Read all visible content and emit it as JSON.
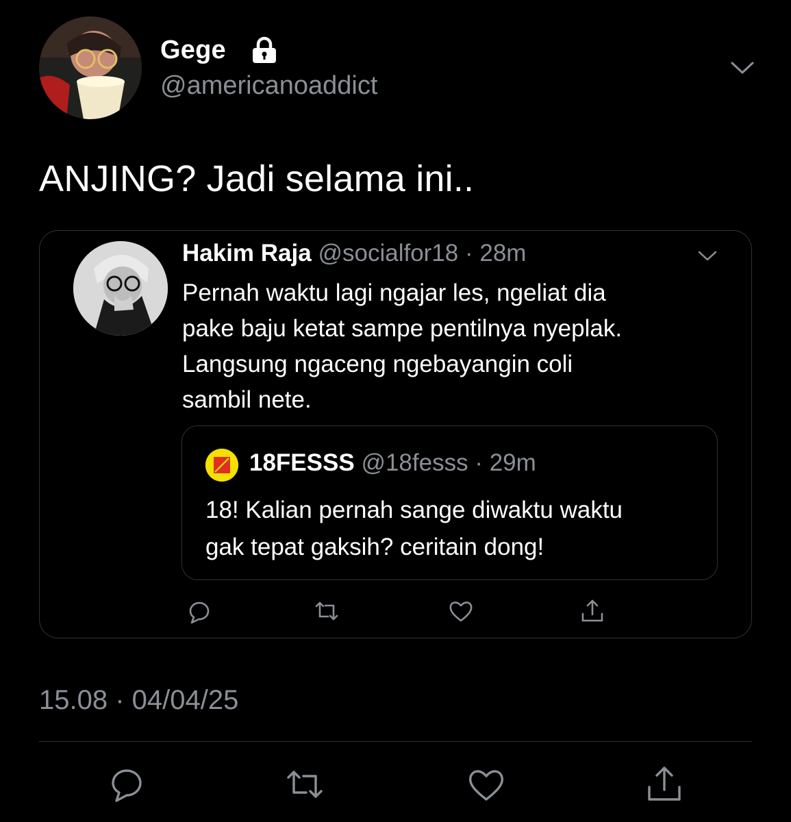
{
  "tweet": {
    "author": {
      "name": "Gege",
      "handle": "@americanoaddict",
      "avatar_icon": "profile-photo",
      "protected_icon": "lock-icon"
    },
    "text": "ANJING? Jadi selama ini..",
    "timestamp": "15.08 · 04/04/25"
  },
  "quoted": {
    "author": {
      "name": "Hakim Raja",
      "handle": "@socialfor18",
      "time": "28m"
    },
    "text_lines": [
      "Pernah waktu lagi ngajar les, ngeliat dia",
      "pake baju ketat sampe pentilnya nyeplak.",
      "Langsung ngaceng ngebayangin coli",
      "sambil nete."
    ],
    "nested": {
      "author": {
        "name": "18FESSS",
        "handle": "@18fesss",
        "time": "29m"
      },
      "text_lines": [
        "18! Kalian pernah sange diwaktu waktu",
        "gak tepat gaksih? ceritain dong!"
      ]
    }
  },
  "colors": {
    "background": "#000000",
    "text": "#ffffff",
    "muted": "#8b8f96",
    "border": "#2f3336",
    "accent_avatar": "#f4e100"
  },
  "icons": [
    "reply-icon",
    "retweet-icon",
    "like-icon",
    "share-icon",
    "chevron-down-icon"
  ]
}
